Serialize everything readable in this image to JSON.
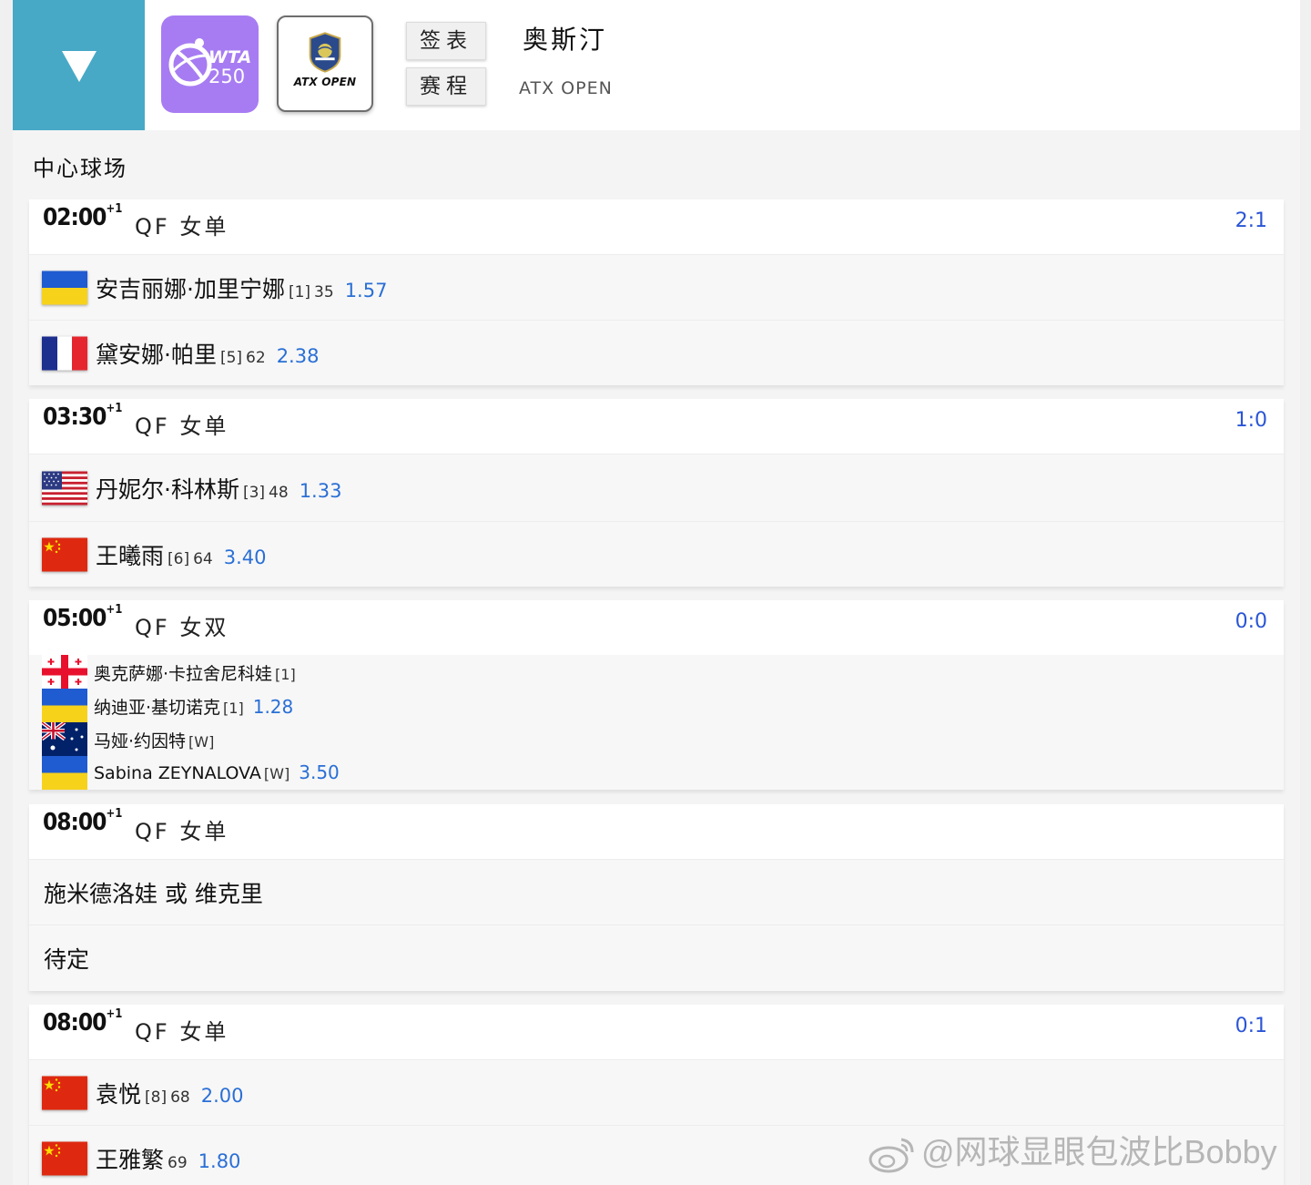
{
  "header": {
    "wta_logo_text": "WTA",
    "wta_logo_number": "250",
    "atx_logo_text": "ATX OPEN",
    "draw_label": "签表",
    "schedule_label": "赛程",
    "tournament_name": "奥斯汀",
    "tournament_sub": "ATX OPEN"
  },
  "court_name": "中心球场",
  "matches": [
    {
      "time": "02:00",
      "day_offset": "+1",
      "round": "QF 女单",
      "score": "2:1",
      "players": [
        {
          "flag": "ukraine",
          "name": "安吉丽娜·加里宁娜",
          "seed": "[1]",
          "rank": "35",
          "odds": "1.57"
        },
        {
          "flag": "france",
          "name": "黛安娜·帕里",
          "seed": "[5]",
          "rank": "62",
          "odds": "2.38"
        }
      ]
    },
    {
      "time": "03:30",
      "day_offset": "+1",
      "round": "QF 女单",
      "score": "1:0",
      "players": [
        {
          "flag": "usa",
          "name": "丹妮尔·科林斯",
          "seed": "[3]",
          "rank": "48",
          "odds": "1.33"
        },
        {
          "flag": "china",
          "name": "王曦雨",
          "seed": "[6]",
          "rank": "64",
          "odds": "3.40"
        }
      ]
    },
    {
      "time": "05:00",
      "day_offset": "+1",
      "round": "QF 女双",
      "score": "0:0",
      "doubles": [
        {
          "flag": "georgia",
          "name": "奥克萨娜·卡拉舍尼科娃",
          "seed": "[1]",
          "odds": ""
        },
        {
          "flag": "ukraine",
          "name": "纳迪亚·基切诺克",
          "seed": "[1]",
          "odds": "1.28"
        },
        {
          "flag": "australia",
          "name": "马娅·约因特",
          "seed": "[W]",
          "odds": ""
        },
        {
          "flag": "ukraine",
          "name": "Sabina ZEYNALOVA",
          "seed": "[W]",
          "odds": "3.50"
        }
      ]
    },
    {
      "time": "08:00",
      "day_offset": "+1",
      "round": "QF 女单",
      "score": "",
      "tbd": [
        "施米德洛娃 或 维克里",
        "待定"
      ]
    },
    {
      "time": "08:00",
      "day_offset": "+1",
      "round": "QF 女单",
      "score": "0:1",
      "players": [
        {
          "flag": "china",
          "name": "袁悦",
          "seed": "[8]",
          "rank": "68",
          "odds": "2.00"
        },
        {
          "flag": "china",
          "name": "王雅繁",
          "seed": "",
          "rank": "69",
          "odds": "1.80"
        }
      ]
    }
  ],
  "watermark": "@网球显眼包波比Bobby",
  "colors": {
    "menu_bg": "#47a9c6",
    "wta_purple": "#a77cf2",
    "score_blue": "#2a55d6",
    "odds_blue": "#2a6fd6"
  }
}
